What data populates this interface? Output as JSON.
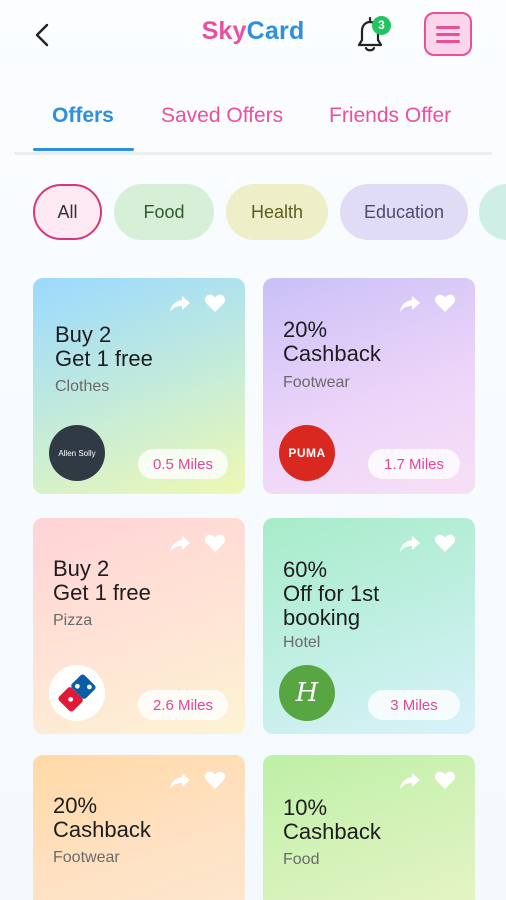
{
  "header": {
    "title_part1": "Sky",
    "title_part2": "Card",
    "notification_count": "3",
    "brand_colors": {
      "pink": "#ec4fa0",
      "blue": "#2d8fe0"
    },
    "icons": {
      "back": "chevron-left-icon",
      "notifications": "bell-icon",
      "menu": "menu-icon"
    }
  },
  "tabs": [
    {
      "label": "Offers",
      "active": true
    },
    {
      "label": "Saved Offers",
      "active": false
    },
    {
      "label": "Friends Offer",
      "active": false
    }
  ],
  "filters": [
    {
      "label": "All",
      "selected": true
    },
    {
      "label": "Food",
      "selected": false
    },
    {
      "label": "Health",
      "selected": false
    },
    {
      "label": "Education",
      "selected": false
    }
  ],
  "offers": [
    {
      "title": "Buy 2\nGet 1 free",
      "category": "Clothes",
      "brand": "Allen Solly",
      "logo_text": "Allen Solly",
      "distance": "0.5 Miles"
    },
    {
      "title": "20%\nCashback",
      "category": "Footwear",
      "brand": "Puma",
      "logo_text": "PUMA",
      "distance": "1.7 Miles"
    },
    {
      "title": "Buy 2\nGet 1 free",
      "category": "Pizza",
      "brand": "Domino's Pizza",
      "distance": "2.6 Miles"
    },
    {
      "title": "60%\nOff for 1st\nbooking",
      "category": "Hotel",
      "brand": "Holiday Inn",
      "logo_text": "H",
      "distance": "3 Miles"
    },
    {
      "title": "20%\nCashback",
      "category": "Footwear"
    },
    {
      "title": "10%\nCashback",
      "category": "Food"
    }
  ]
}
